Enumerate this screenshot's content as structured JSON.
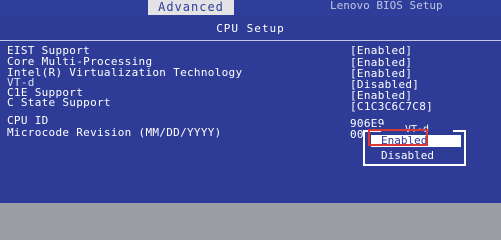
{
  "header": {
    "tab_label": "Advanced",
    "right_text": "Lenovo BIOS Setup"
  },
  "panel": {
    "title": "CPU Setup"
  },
  "settings": [
    {
      "label": "EIST Support",
      "value": "[Enabled]"
    },
    {
      "label": "Core Multi-Processing",
      "value": "[Enabled]"
    },
    {
      "label": "Intel(R) Virtualization Technology",
      "value": "[Enabled]"
    },
    {
      "label": "VT-d",
      "value": "[Disabled]"
    },
    {
      "label": "C1E Support",
      "value": "[Enabled]"
    },
    {
      "label": "C State Support",
      "value": "[C1C3C6C7C8]"
    }
  ],
  "info": [
    {
      "label": "CPU ID",
      "value": "906E9"
    },
    {
      "label": "Microcode Revision (MM/DD/YYYY)",
      "value": "00"
    }
  ],
  "popup": {
    "title": "VT-d",
    "options": [
      "Enabled",
      "Disabled"
    ]
  },
  "colors": {
    "background": "#2e3c98",
    "text": "#ffffff",
    "highlight_border": "#d83838"
  }
}
